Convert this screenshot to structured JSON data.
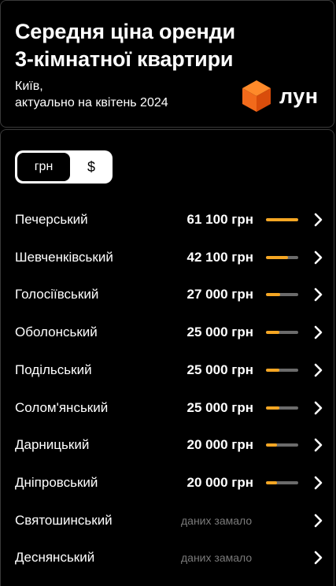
{
  "header": {
    "title": "Середня ціна оренди\n3-кімнатної квартири",
    "subtitle": "Київ,\nактуально на квітень 2024",
    "logo_text": "лун"
  },
  "currency": {
    "options": [
      "грн",
      "$"
    ],
    "selected": "грн"
  },
  "colors": {
    "accent": "#f5a623",
    "bar_track": "#6b6b6b",
    "nodata_text": "#7a7a7a",
    "logo_orange": "#f26a1b"
  },
  "districts": [
    {
      "name": "Печерський",
      "price": "61 100 грн",
      "value": 61100
    },
    {
      "name": "Шевченківський",
      "price": "42 100 грн",
      "value": 42100
    },
    {
      "name": "Голосіївський",
      "price": "27 000 грн",
      "value": 27000
    },
    {
      "name": "Оболонський",
      "price": "25 000 грн",
      "value": 25000
    },
    {
      "name": "Подільський",
      "price": "25 000 грн",
      "value": 25000
    },
    {
      "name": "Солом'янський",
      "price": "25 000 грн",
      "value": 25000
    },
    {
      "name": "Дарницький",
      "price": "20 000 грн",
      "value": 20000
    },
    {
      "name": "Дніпровський",
      "price": "20 000 грн",
      "value": 20000
    },
    {
      "name": "Святошинський",
      "nodata": "даних замало"
    },
    {
      "name": "Деснянський",
      "nodata": "даних замало"
    }
  ]
}
